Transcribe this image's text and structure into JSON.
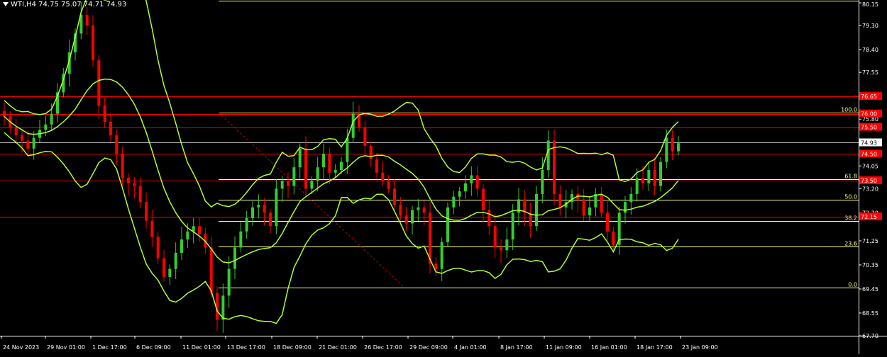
{
  "chart_data": {
    "type": "candlestick",
    "title": "WTI,H4  74.75 75.07 74.71 74.93",
    "symbol": "WTI",
    "timeframe": "H4",
    "ohlc_header": {
      "open": 74.75,
      "high": 75.07,
      "low": 74.71,
      "close": 74.93
    },
    "colors": {
      "background": "#000000",
      "up": "#32cd32",
      "down": "#ff0000",
      "bollinger": "#adff2f",
      "fibo": "#ffff80",
      "level_line": "#ff0000",
      "text": "#ffffff"
    },
    "ylim": [
      67.7,
      80.15
    ],
    "y_ticks": [
      "80.15",
      "79.30",
      "78.40",
      "77.55",
      "76.65",
      "75.80",
      "74.90",
      "74.05",
      "73.20",
      "72.30",
      "71.25",
      "70.35",
      "69.45",
      "68.55",
      "67.70"
    ],
    "x_ticks": [
      "24 Nov 2023",
      "29 Nov 01:00",
      "1 Dec 17:00",
      "6 Dec 09:00",
      "11 Dec 01:00",
      "13 Dec 17:00",
      "18 Dec 09:00",
      "21 Dec 01:00",
      "26 Dec 17:00",
      "29 Dec 09:00",
      "4 Jan 01:00",
      "8 Jan 17:00",
      "11 Jan 09:00",
      "16 Jan 01:00",
      "18 Jan 17:00",
      "23 Jan 09:00"
    ],
    "current_price": "74.93",
    "horizontal_levels": [
      {
        "label": "76.65",
        "value": 76.65
      },
      {
        "label": "76.00",
        "value": 76.0
      },
      {
        "label": "75.50",
        "value": 75.5
      },
      {
        "label": "74.50",
        "value": 74.5
      },
      {
        "label": "73.50",
        "value": 73.5
      },
      {
        "label": "72.15",
        "value": 72.15
      }
    ],
    "fibonacci": {
      "levels": [
        {
          "label": "100.0",
          "value": 76.05
        },
        {
          "label": "61.8",
          "value": 73.55
        },
        {
          "label": "50.0",
          "value": 72.78
        },
        {
          "label": "38.2",
          "value": 72.0
        },
        {
          "label": "23.6",
          "value": 71.05
        },
        {
          "label": "0.0",
          "value": 69.5
        }
      ]
    },
    "close_series": [
      75.9,
      75.5,
      75.2,
      75.0,
      74.7,
      75.1,
      75.4,
      75.6,
      76.0,
      76.8,
      77.5,
      78.3,
      79.0,
      79.7,
      79.3,
      78.0,
      76.3,
      75.7,
      75.2,
      74.5,
      73.6,
      73.4,
      73.3,
      72.7,
      72.0,
      71.4,
      70.6,
      69.9,
      70.2,
      70.8,
      71.3,
      71.6,
      71.8,
      71.5,
      71.0,
      69.3,
      68.3,
      69.2,
      70.2,
      71.0,
      71.6,
      72.1,
      72.5,
      72.6,
      72.3,
      71.8,
      73.2,
      73.5,
      73.3,
      74.0,
      74.7,
      73.2,
      73.5,
      74.0,
      74.5,
      73.8,
      73.9,
      74.2,
      75.1,
      76.0,
      75.5,
      74.8,
      74.3,
      73.8,
      73.5,
      73.2,
      72.6,
      72.2,
      71.9,
      72.4,
      72.5,
      72.3,
      70.4,
      70.2,
      71.2,
      72.5,
      72.9,
      73.1,
      73.4,
      73.7,
      73.2,
      72.4,
      71.8,
      71.0,
      70.9,
      71.3,
      72.3,
      72.8,
      72.3,
      71.8,
      73.0,
      73.9,
      75.0,
      73.0,
      72.5,
      72.7,
      73.0,
      72.8,
      72.2,
      72.5,
      73.0,
      72.3,
      71.6,
      71.1,
      72.3,
      72.7,
      73.0,
      73.6,
      73.4,
      73.9,
      73.3,
      74.2,
      75.1,
      74.6,
      74.9
    ]
  }
}
